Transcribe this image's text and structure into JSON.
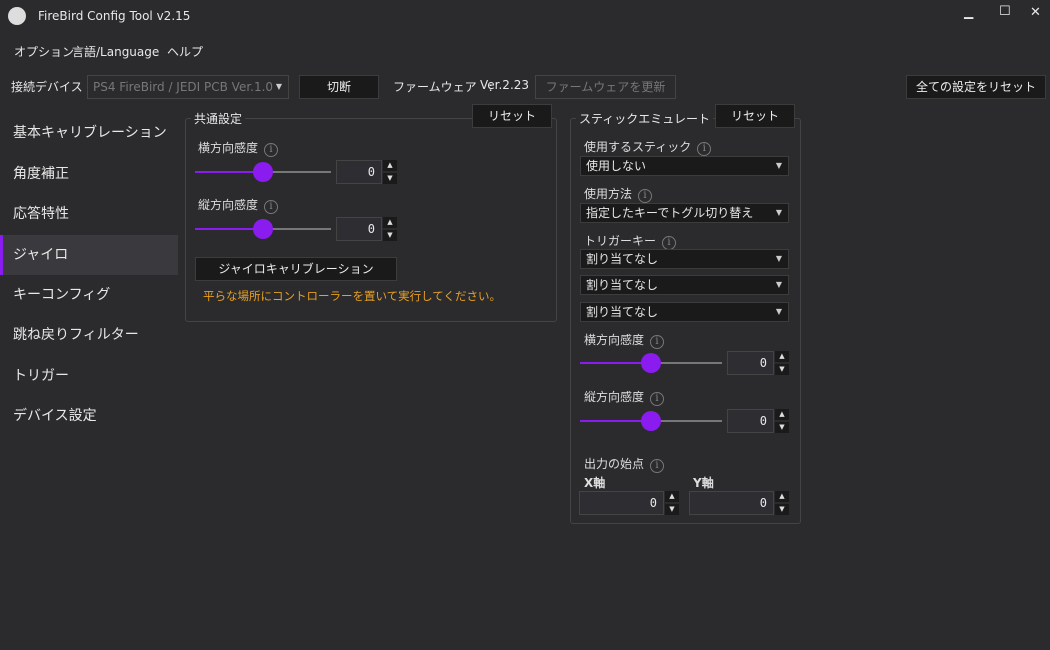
{
  "window": {
    "title": "FireBird Config Tool v2.15",
    "minimize": "▁",
    "maximize": "☐",
    "close": "✕"
  },
  "menu": [
    "オプション",
    "言語/Language",
    "ヘルプ"
  ],
  "toolbar": {
    "device_label": "接続デバイス",
    "device_value": "PS4 FireBird / JEDI PCB Ver.1.0",
    "disconnect": "切断",
    "firmware_label": "ファームウェア　:",
    "firmware_version": "Ver.2.23",
    "update_firmware": "ファームウェアを更新",
    "reset_all": "全ての設定をリセット"
  },
  "sidebar": {
    "items": [
      "基本キャリブレーション",
      "角度補正",
      "応答特性",
      "ジャイロ",
      "キーコンフィグ",
      "跳ね戻りフィルター",
      "トリガー",
      "デバイス設定"
    ],
    "selected": "ジャイロ"
  },
  "common": {
    "title": "共通設定",
    "reset": "リセット",
    "h_sens": "横方向感度",
    "h_value": "0",
    "h_slider": 50,
    "v_sens": "縦方向感度",
    "v_value": "0",
    "v_slider": 50,
    "calibrate": "ジャイロキャリブレーション",
    "hint": "平らな場所にコントローラーを置いて実行してください。"
  },
  "stick": {
    "title": "スティックエミュレート",
    "reset": "リセット",
    "use_stick_label": "使用するスティック",
    "use_stick_value": "使用しない",
    "method_label": "使用方法",
    "method_value": "指定したキーでトグル切り替え",
    "trigger_label": "トリガーキー",
    "trigger_values": [
      "割り当てなし",
      "割り当てなし",
      "割り当てなし"
    ],
    "h_sens": "横方向感度",
    "h_value": "0",
    "h_slider": 50,
    "v_sens": "縦方向感度",
    "v_value": "0",
    "v_slider": 50,
    "origin_label": "出力の始点",
    "x_label": "X軸",
    "x_value": "0",
    "y_label": "Y軸",
    "y_value": "0"
  },
  "colors": {
    "accent": "#8a1cf0",
    "hint": "#e8a020"
  }
}
